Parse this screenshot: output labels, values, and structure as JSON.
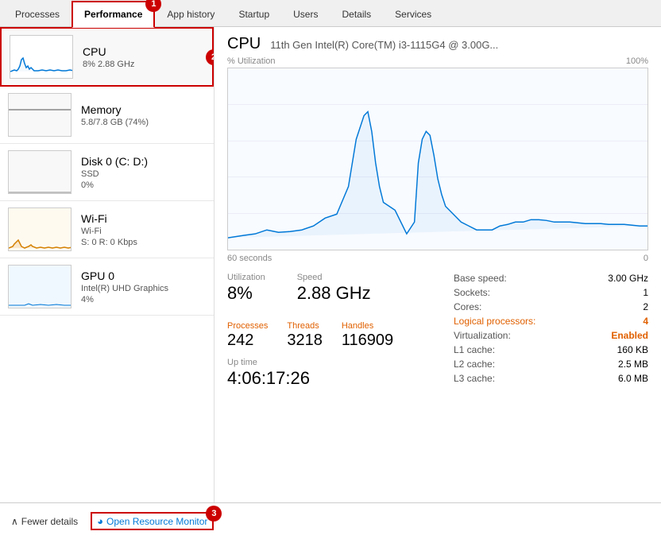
{
  "tabs": [
    {
      "label": "Processes",
      "active": false
    },
    {
      "label": "Performance",
      "active": true
    },
    {
      "label": "App history",
      "active": false
    },
    {
      "label": "Startup",
      "active": false
    },
    {
      "label": "Users",
      "active": false
    },
    {
      "label": "Details",
      "active": false
    },
    {
      "label": "Services",
      "active": false
    }
  ],
  "sidebar": {
    "items": [
      {
        "name": "CPU",
        "detail1": "8% 2.88 GHz",
        "active": true,
        "chart_color": "#0078d7"
      },
      {
        "name": "Memory",
        "detail1": "5.8/7.8 GB (74%)",
        "active": false,
        "chart_color": "#888"
      },
      {
        "name": "Disk 0 (C: D:)",
        "detail1": "SSD",
        "detail2": "0%",
        "active": false,
        "chart_color": "#888"
      },
      {
        "name": "Wi-Fi",
        "detail1": "Wi-Fi",
        "detail2": "S: 0 R: 0 Kbps",
        "active": false,
        "chart_color": "#d48000"
      },
      {
        "name": "GPU 0",
        "detail1": "Intel(R) UHD Graphics",
        "detail2": "4%",
        "active": false,
        "chart_color": "#0078d7"
      }
    ]
  },
  "cpu_panel": {
    "title": "CPU",
    "model": "11th Gen Intel(R) Core(TM) i3-1115G4 @ 3.00G...",
    "chart_label_left": "% Utilization",
    "chart_label_right": "100%",
    "time_left": "60 seconds",
    "time_right": "0",
    "utilization_label": "Utilization",
    "utilization_value": "8%",
    "speed_label": "Speed",
    "speed_value": "2.88 GHz",
    "processes_label": "Processes",
    "processes_value": "242",
    "threads_label": "Threads",
    "threads_value": "3218",
    "handles_label": "Handles",
    "handles_value": "116909",
    "uptime_label": "Up time",
    "uptime_value": "4:06:17:26",
    "info": [
      {
        "key": "Base speed:",
        "value": "3.00 GHz",
        "accent": false
      },
      {
        "key": "Sockets:",
        "value": "1",
        "accent": false
      },
      {
        "key": "Cores:",
        "value": "2",
        "accent": false
      },
      {
        "key": "Logical processors:",
        "value": "4",
        "accent": true
      },
      {
        "key": "Virtualization:",
        "value": "Enabled",
        "accent": true
      },
      {
        "key": "L1 cache:",
        "value": "160 KB",
        "accent": false
      },
      {
        "key": "L2 cache:",
        "value": "2.5 MB",
        "accent": false
      },
      {
        "key": "L3 cache:",
        "value": "6.0 MB",
        "accent": false
      }
    ]
  },
  "footer": {
    "fewer_details": "Fewer details",
    "open_monitor": "Open Resource Monitor"
  },
  "badges": {
    "tab_badge": "1",
    "sidebar_badge": "2",
    "footer_badge": "3"
  }
}
